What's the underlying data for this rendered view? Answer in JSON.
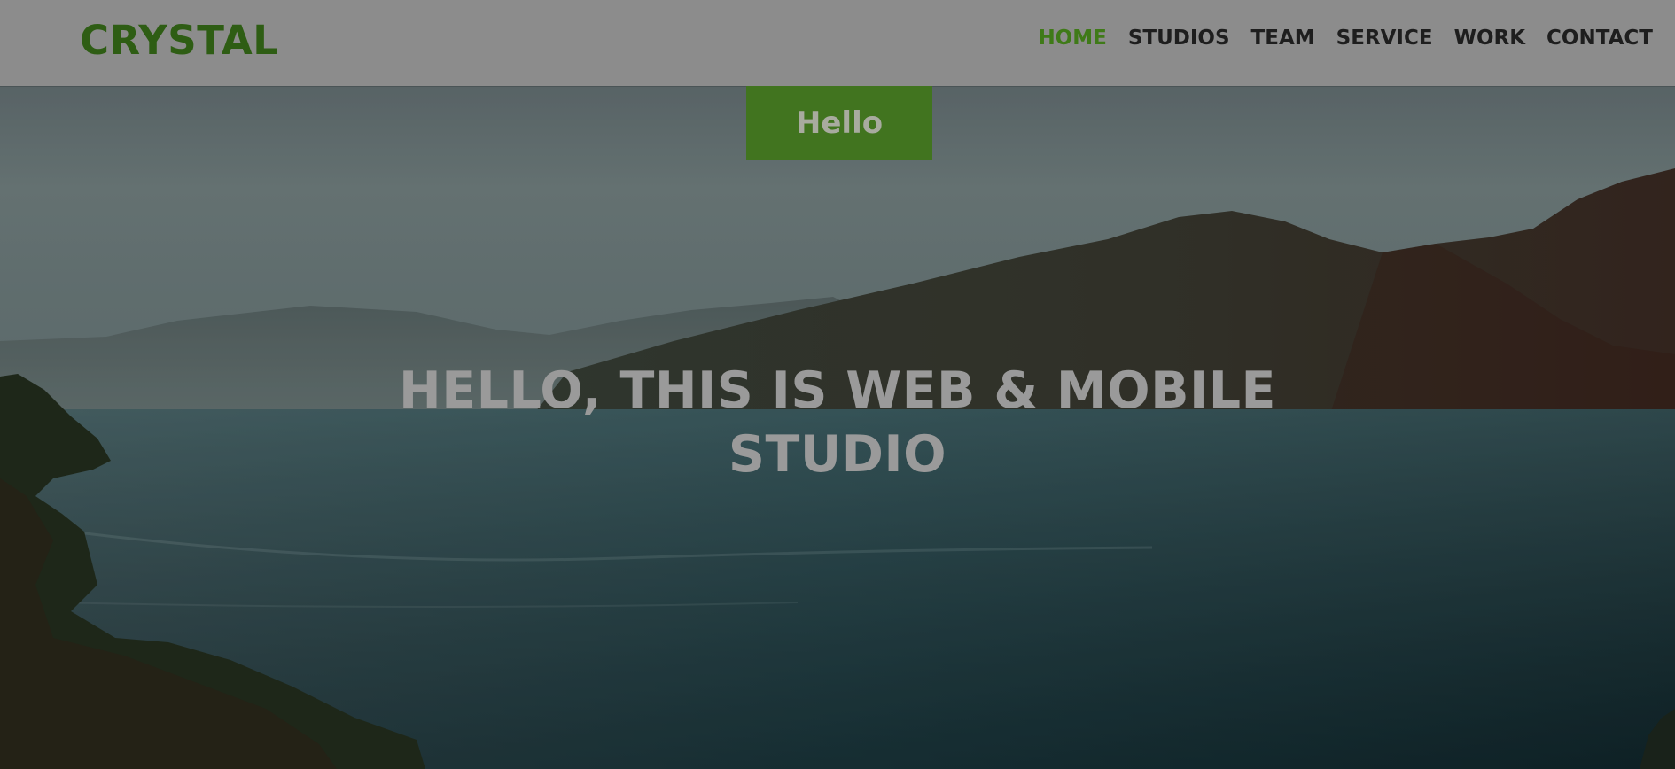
{
  "brand": {
    "logo_text": "CRYSTAL",
    "accent_color": "#3f7a18"
  },
  "nav": {
    "items": [
      {
        "label": "HOME",
        "active": true
      },
      {
        "label": "STUDIOS",
        "active": false
      },
      {
        "label": "TEAM",
        "active": false
      },
      {
        "label": "SERVICE",
        "active": false
      },
      {
        "label": "WORK",
        "active": false
      },
      {
        "label": "CONTACT",
        "active": false
      }
    ]
  },
  "hero": {
    "tab_label": "Hello",
    "headline_line1": "HELLO, THIS IS WEB & MOBILE",
    "headline_line2": "STUDIO",
    "background": "lake-mountain-landscape"
  }
}
